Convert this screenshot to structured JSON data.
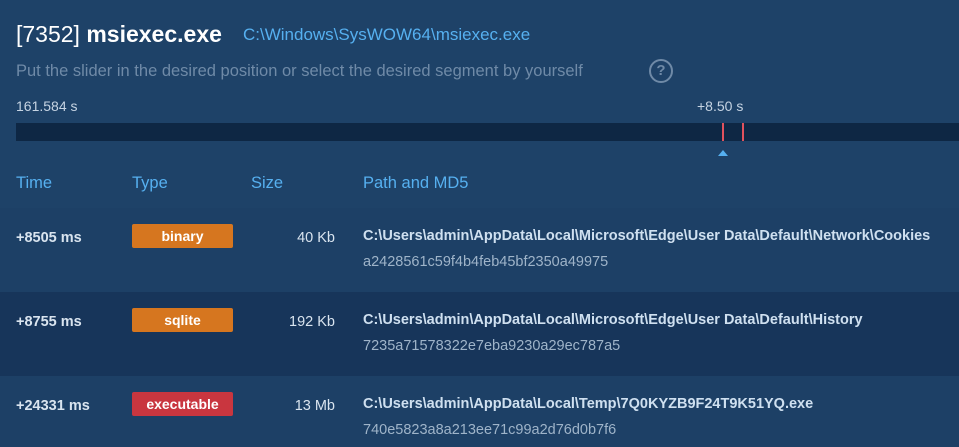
{
  "process": {
    "pid": "[7352]",
    "name": "msiexec.exe",
    "path": "C:\\Windows\\SysWOW64\\msiexec.exe"
  },
  "hint": "Put the slider in the desired position or select the desired segment by yourself",
  "help_icon": "question-circle-icon",
  "timeline": {
    "start_label": "161.584 s",
    "offset_label": "+8.50 s"
  },
  "colors": {
    "background": "#1e4268",
    "accent": "#56b0f0",
    "marker": "#e0525e",
    "badge_binary": "#d6761f",
    "badge_sqlite": "#d6761f",
    "badge_executable": "#c9363f"
  },
  "table": {
    "columns": [
      "Time",
      "Type",
      "Size",
      "Path and MD5"
    ],
    "rows": [
      {
        "time": "+8505 ms",
        "type": "binary",
        "size": "40 Kb",
        "path": "C:\\Users\\admin\\AppData\\Local\\Microsoft\\Edge\\User Data\\Default\\Network\\Cookies",
        "md5": "a2428561c59f4b4feb45bf2350a49975"
      },
      {
        "time": "+8755 ms",
        "type": "sqlite",
        "size": "192 Kb",
        "path": "C:\\Users\\admin\\AppData\\Local\\Microsoft\\Edge\\User Data\\Default\\History",
        "md5": "7235a71578322e7eba9230a29ec787a5"
      },
      {
        "time": "+24331 ms",
        "type": "executable",
        "size": "13 Mb",
        "path": "C:\\Users\\admin\\AppData\\Local\\Temp\\7Q0KYZB9F24T9K51YQ.exe",
        "md5": "740e5823a8a213ee71c99a2d76d0b7f6"
      }
    ]
  }
}
